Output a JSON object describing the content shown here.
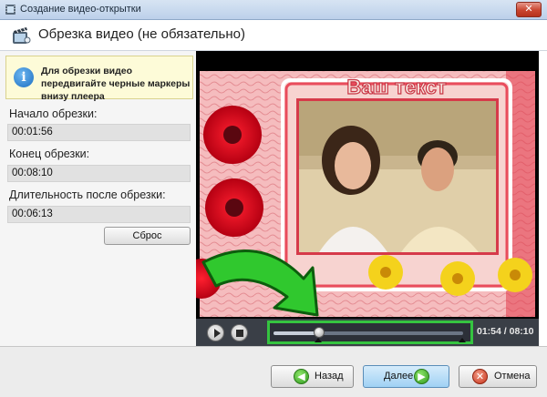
{
  "window": {
    "title": "Создание видео-открытки",
    "close_symbol": "✕",
    "app_icon": "film-strip-icon"
  },
  "header": {
    "title": "Обрезка видео (не обязательно)",
    "icon": "film-clapper-icon"
  },
  "hint": {
    "icon": "info-icon",
    "icon_glyph": "i",
    "text": "Для обрезки видео передвигайте черные маркеры внизу плеера"
  },
  "trim": {
    "start_label": "Начало обрезки:",
    "start_value": "00:01:56",
    "end_label": "Конец обрезки:",
    "end_value": "00:08:10",
    "duration_label": "Длительность после обрезки:",
    "duration_value": "00:06:13",
    "reset_label": "Сброс"
  },
  "preview": {
    "overlay_text": "Ваш текст"
  },
  "player": {
    "timecode": "01:54 / 08:10",
    "progress": 0.24,
    "play_icon": "play-icon",
    "stop_icon": "stop-icon"
  },
  "buttons": {
    "back_label": "Назад",
    "next_label": "Далее",
    "cancel_label": "Отмена",
    "back_icon_glyph": "◀",
    "next_icon_glyph": "▶",
    "cancel_icon_glyph": "✕"
  },
  "colors": {
    "highlight_green": "#35c440",
    "primary_button": "#9fd1f4",
    "hint_background": "#fdfbd8"
  }
}
